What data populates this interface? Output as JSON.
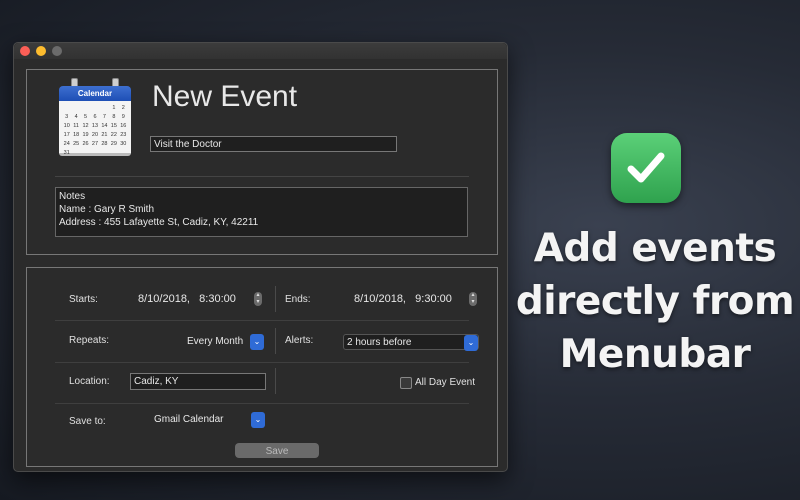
{
  "window": {
    "title": "New Event",
    "calendar_icon": {
      "label": "Calendar",
      "days": [
        "",
        "",
        "",
        "",
        "",
        "1",
        "2",
        "3",
        "4",
        "5",
        "6",
        "7",
        "8",
        "9",
        "10",
        "11",
        "12",
        "13",
        "14",
        "15",
        "16",
        "17",
        "18",
        "19",
        "20",
        "21",
        "22",
        "23",
        "24",
        "25",
        "26",
        "27",
        "28",
        "29",
        "30",
        "31"
      ]
    },
    "event_title_value": "Visit the Doctor",
    "notes_lines": [
      "Notes",
      "Name : Gary R Smith",
      "Address : 455 Lafayette St, Cadiz, KY, 42211"
    ],
    "starts": {
      "label": "Starts:",
      "value": "8/10/2018,   8:30:00"
    },
    "ends": {
      "label": "Ends:",
      "value": "8/10/2018,   9:30:00"
    },
    "repeats": {
      "label": "Repeats:",
      "value": "Every Month"
    },
    "alerts": {
      "label": "Alerts:",
      "value": "2 hours before"
    },
    "location": {
      "label": "Location:",
      "value": "Cadiz, KY"
    },
    "all_day": {
      "label": "All Day Event",
      "checked": false
    },
    "save_to": {
      "label": "Save to:",
      "value": "Gmail Calendar"
    },
    "save_label": "Save"
  },
  "promo": {
    "badge_icon": "checkmark-icon",
    "lines": [
      "Add events",
      "directly from",
      "Menubar"
    ]
  },
  "colors": {
    "accent": "#2f6bd6",
    "badge": "#3bb45a",
    "background": "#262b36"
  }
}
